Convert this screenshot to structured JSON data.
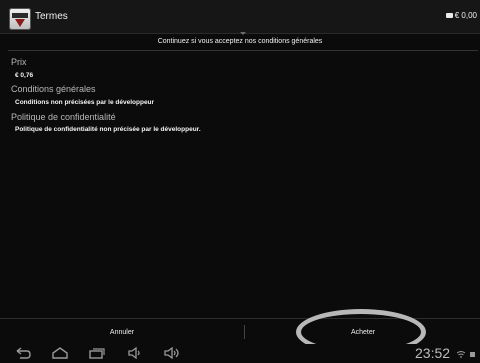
{
  "header": {
    "app_icon": "app-badge-icon",
    "title": "Termes",
    "cart_icon": "cart-icon",
    "balance": "€ 0,00"
  },
  "subtitle": "Continuez si vous acceptez nos conditions générales",
  "sections": {
    "price": {
      "heading": "Prix",
      "value": "€ 0,76"
    },
    "terms": {
      "heading": "Conditions générales",
      "value": "Conditions non précisées par le développeur"
    },
    "privacy": {
      "heading": "Politique de confidentialité",
      "value": "Politique de confidentialité non précisée par le développeur."
    }
  },
  "actions": {
    "cancel_label": "Annuler",
    "buy_label": "Acheter"
  },
  "navbar": {
    "icons": [
      "back-icon",
      "home-icon",
      "recent-apps-icon",
      "volume-down-icon",
      "volume-up-icon"
    ],
    "time": "23:52",
    "status_icons": [
      "wifi-icon",
      "battery-icon"
    ]
  },
  "colors": {
    "background": "#0b0b0b",
    "highlight_ring": "#b8b8b8"
  }
}
